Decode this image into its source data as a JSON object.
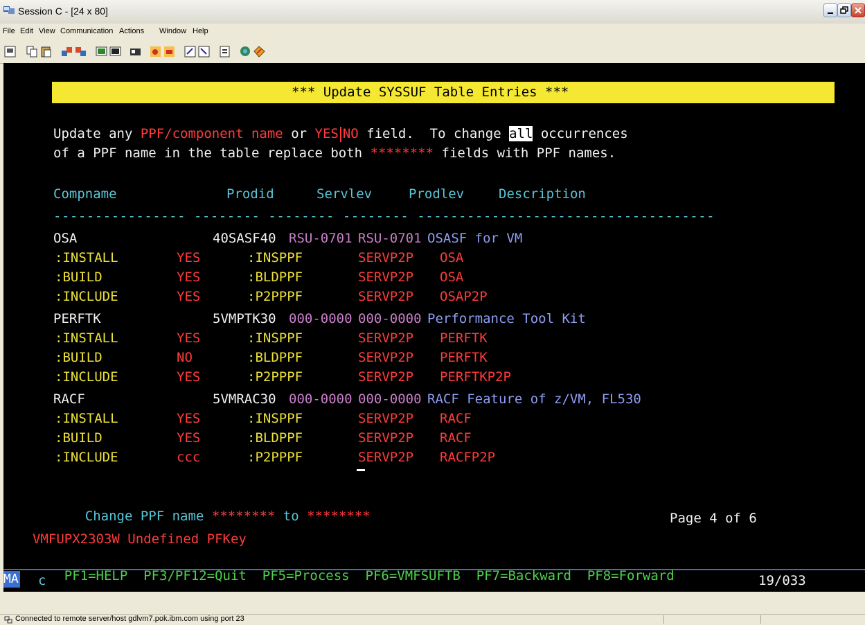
{
  "window": {
    "title": "Session C - [24 x 80]",
    "accent": "#3a6fd0"
  },
  "menubar": {
    "items": [
      "File",
      "Edit",
      "View",
      "Communication",
      "Actions",
      "Window",
      "Help"
    ]
  },
  "toolbar": {
    "icons": [
      "print-icon",
      "copy-icon",
      "paste-icon",
      "send-file-icon",
      "receive-file-icon",
      "display-icon",
      "keypad-icon",
      "macro-icon",
      "record-icon",
      "playback-icon",
      "transfer-icon",
      "transfer-list-icon",
      "clipboard-icon",
      "globe-icon",
      "diamond-icon"
    ]
  },
  "screen": {
    "banner": "*** Update SYSSUF Table Entries ***",
    "instructions": {
      "line1": {
        "a": "Update any ",
        "b": "PPF/component name",
        "c": " or ",
        "d": "YES",
        "e": "NO",
        "f": " field.  To change ",
        "g": "all",
        "h": " occurrences"
      },
      "line2": {
        "a": "of a PPF name in the table replace both ",
        "b": "********",
        "c": " fields with PPF names."
      }
    },
    "headers": {
      "compname": "Compname",
      "prodid": "Prodid",
      "servlev": "Servlev",
      "prodlev": "Prodlev",
      "description": "Description",
      "rule": "---------------- -------- -------- -------- ------------------------------------"
    },
    "components": [
      {
        "name": "OSA",
        "prodid": "40SASF40",
        "servlev": "RSU-0701",
        "prodlev": "RSU-0701",
        "description": "OSASF for VM",
        "rows": [
          {
            "label": ":INSTALL",
            "value": "YES",
            "ppf_label": ":INSPPF",
            "ppf": "SERVP2P",
            "comp": "OSA"
          },
          {
            "label": ":BUILD",
            "value": "YES",
            "ppf_label": ":BLDPPF",
            "ppf": "SERVP2P",
            "comp": "OSA"
          },
          {
            "label": ":INCLUDE",
            "value": "YES",
            "ppf_label": ":P2PPPF",
            "ppf": "SERVP2P",
            "comp": "OSAP2P"
          }
        ]
      },
      {
        "name": "PERFTK",
        "prodid": "5VMPTK30",
        "servlev": "000-0000",
        "prodlev": "000-0000",
        "description": "Performance Tool Kit",
        "rows": [
          {
            "label": ":INSTALL",
            "value": "YES",
            "ppf_label": ":INSPPF",
            "ppf": "SERVP2P",
            "comp": "PERFTK"
          },
          {
            "label": ":BUILD",
            "value": "NO",
            "ppf_label": ":BLDPPF",
            "ppf": "SERVP2P",
            "comp": "PERFTK"
          },
          {
            "label": ":INCLUDE",
            "value": "YES",
            "ppf_label": ":P2PPPF",
            "ppf": "SERVP2P",
            "comp": "PERFTKP2P"
          }
        ]
      },
      {
        "name": "RACF",
        "prodid": "5VMRAC30",
        "servlev": "000-0000",
        "prodlev": "000-0000",
        "description": "RACF Feature of z/VM, FL530",
        "rows": [
          {
            "label": ":INSTALL",
            "value": "YES",
            "ppf_label": ":INSPPF",
            "ppf": "SERVP2P",
            "comp": "RACF"
          },
          {
            "label": ":BUILD",
            "value": "YES",
            "ppf_label": ":BLDPPF",
            "ppf": "SERVP2P",
            "comp": "RACF"
          },
          {
            "label": ":INCLUDE",
            "value": "ccc",
            "ppf_label": ":P2PPPF",
            "ppf": "SERVP2P",
            "comp": "RACFP2P"
          }
        ]
      }
    ],
    "change_line": {
      "label": "Change PPF name",
      "from": "********",
      "to_word": "to",
      "to": "********"
    },
    "page": "Page 4 of 6",
    "message": "VMFUPX2303W Undefined PFKey",
    "pfkeys": [
      "PF1=HELP",
      "PF3/PF12=Quit",
      "PF5=Process",
      "PF6=VMFSUFTB",
      "PF7=Backward",
      "PF8=Forward"
    ],
    "oia": {
      "indicator": "MA",
      "input": "c",
      "cursor_pos": "19/033"
    }
  },
  "statusbar": {
    "text": "Connected to remote server/host gdlvm7.pok.ibm.com using port 23"
  }
}
